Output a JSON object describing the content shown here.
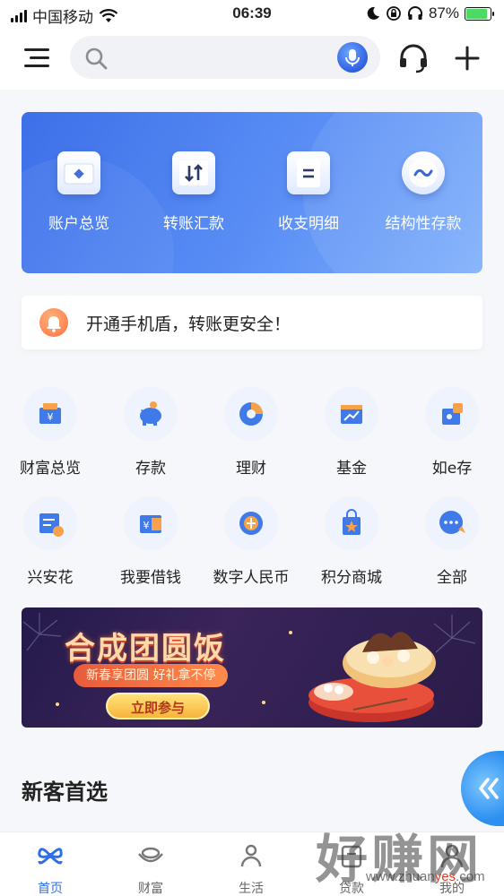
{
  "status_bar": {
    "carrier": "中国移动",
    "time": "06:39",
    "battery": "87%",
    "battery_level": 0.87
  },
  "top_bar": {
    "menu_icon": "hamburger-icon",
    "search_icon": "search-icon",
    "search_placeholder": "",
    "voice_icon": "microphone-icon",
    "service_icon": "headset-icon",
    "add_icon": "plus-icon"
  },
  "quick_actions": [
    {
      "label": "账户总览",
      "icon": "wallet-icon"
    },
    {
      "label": "转账汇款",
      "icon": "transfer-icon"
    },
    {
      "label": "收支明细",
      "icon": "detail-list-icon"
    },
    {
      "label": "结构性存款",
      "icon": "wave-icon"
    }
  ],
  "notice": {
    "icon": "bell-icon",
    "text": "开通手机盾，转账更安全！"
  },
  "services": [
    {
      "label": "财富总览",
      "icon": "wealth-box-icon"
    },
    {
      "label": "存款",
      "icon": "piggy-bank-icon"
    },
    {
      "label": "理财",
      "icon": "pie-chart-icon"
    },
    {
      "label": "基金",
      "icon": "fund-chart-icon"
    },
    {
      "label": "如e存",
      "icon": "puzzle-icon"
    },
    {
      "label": "兴安花",
      "icon": "card-icon"
    },
    {
      "label": "我要借钱",
      "icon": "loan-folder-icon"
    },
    {
      "label": "数字人民币",
      "icon": "digital-coin-icon"
    },
    {
      "label": "积分商城",
      "icon": "shopping-bag-icon"
    },
    {
      "label": "全部",
      "icon": "more-chat-icon"
    }
  ],
  "banner": {
    "title": "合成团圆饭",
    "subtitle": "新春享团圆  好礼拿不停",
    "button": "立即参与"
  },
  "section": {
    "title": "新客首选"
  },
  "tab_bar": [
    {
      "label": "首页",
      "icon": "home-clover-icon",
      "active": true
    },
    {
      "label": "财富",
      "icon": "ingot-icon",
      "active": false
    },
    {
      "label": "生活",
      "icon": "people-icon",
      "active": false
    },
    {
      "label": "贷款",
      "icon": "loan-icon",
      "active": false
    },
    {
      "label": "我的",
      "icon": "user-icon",
      "active": false
    }
  ],
  "watermark": {
    "main": "好赚网",
    "url_prefix": "www.zhuan",
    "url_highlight": "yes",
    "url_suffix": ".com"
  },
  "colors": {
    "primary": "#2f6fe4",
    "card_gradient_start": "#3d6fe8",
    "card_gradient_end": "#7fb0fb",
    "banner_bg": "#2a1c4a"
  }
}
